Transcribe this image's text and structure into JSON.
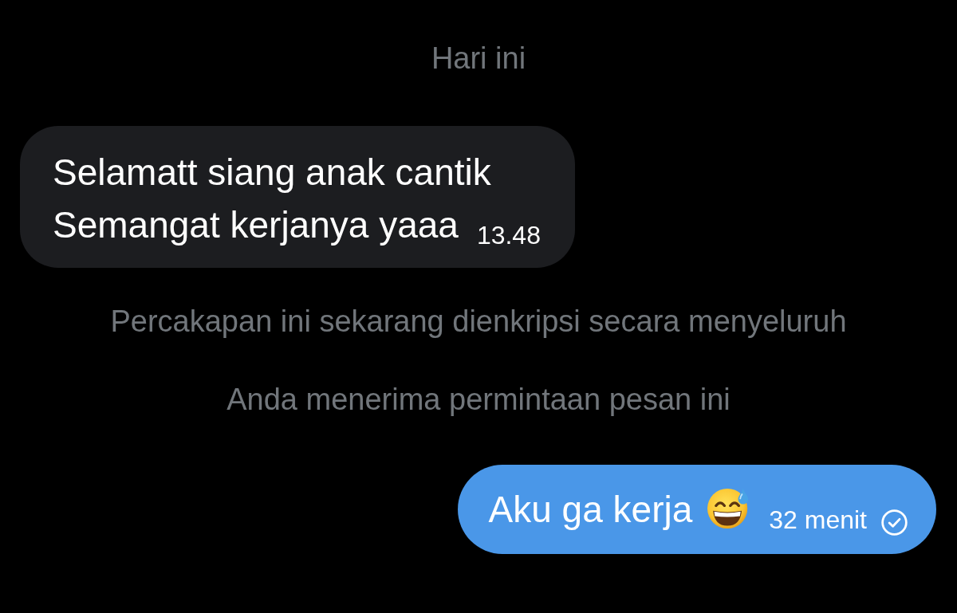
{
  "thread": [
    {
      "kind": "date",
      "label": "Hari ini"
    },
    {
      "kind": "received",
      "lines": [
        "Selamatt siang anak cantik",
        "Semangat kerjanya yaaa"
      ],
      "time": "13.48"
    },
    {
      "kind": "notice",
      "text": "Percakapan ini sekarang dienkripsi secara menyeluruh"
    },
    {
      "kind": "notice",
      "text": "Anda menerima permintaan pesan ini"
    },
    {
      "kind": "sent",
      "lines": [
        "Aku ga kerja"
      ],
      "emoji": true,
      "time": "32 menit",
      "sent": true
    }
  ]
}
